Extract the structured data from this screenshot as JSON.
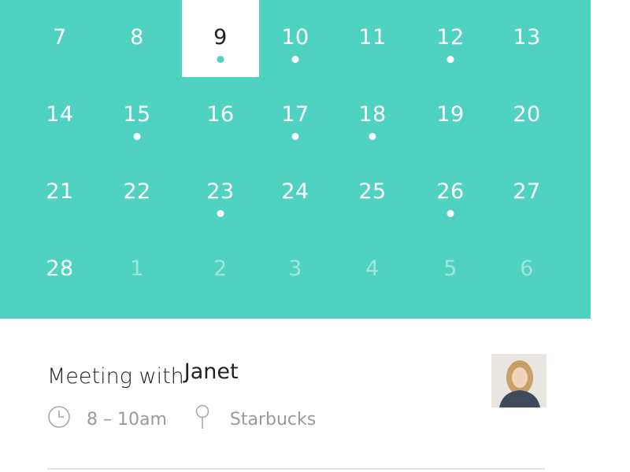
{
  "calendar": {
    "rows": [
      [
        {
          "d": "7"
        },
        {
          "d": "8"
        },
        {
          "d": "9",
          "selected": true,
          "dot": true
        },
        {
          "d": "10",
          "dot": true
        },
        {
          "d": "11"
        },
        {
          "d": "12",
          "dot": true
        },
        {
          "d": "13"
        }
      ],
      [
        {
          "d": "14"
        },
        {
          "d": "15",
          "dot": true
        },
        {
          "d": "16"
        },
        {
          "d": "17",
          "dot": true
        },
        {
          "d": "18",
          "dot": true
        },
        {
          "d": "19"
        },
        {
          "d": "20"
        }
      ],
      [
        {
          "d": "21"
        },
        {
          "d": "22"
        },
        {
          "d": "23",
          "dot": true
        },
        {
          "d": "24"
        },
        {
          "d": "25"
        },
        {
          "d": "26",
          "dot": true
        },
        {
          "d": "27"
        }
      ],
      [
        {
          "d": "28"
        },
        {
          "d": "1",
          "muted": true
        },
        {
          "d": "2",
          "muted": true
        },
        {
          "d": "3",
          "muted": true
        },
        {
          "d": "4",
          "muted": true
        },
        {
          "d": "5",
          "muted": true
        },
        {
          "d": "6",
          "muted": true
        }
      ]
    ],
    "accent_color": "#4fd2c2"
  },
  "event": {
    "title_prefix": "Meeting with",
    "title_name": "Janet",
    "time": "8 – 10am",
    "location": "Starbucks",
    "time_icon": "clock-icon",
    "location_icon": "pin-icon"
  }
}
